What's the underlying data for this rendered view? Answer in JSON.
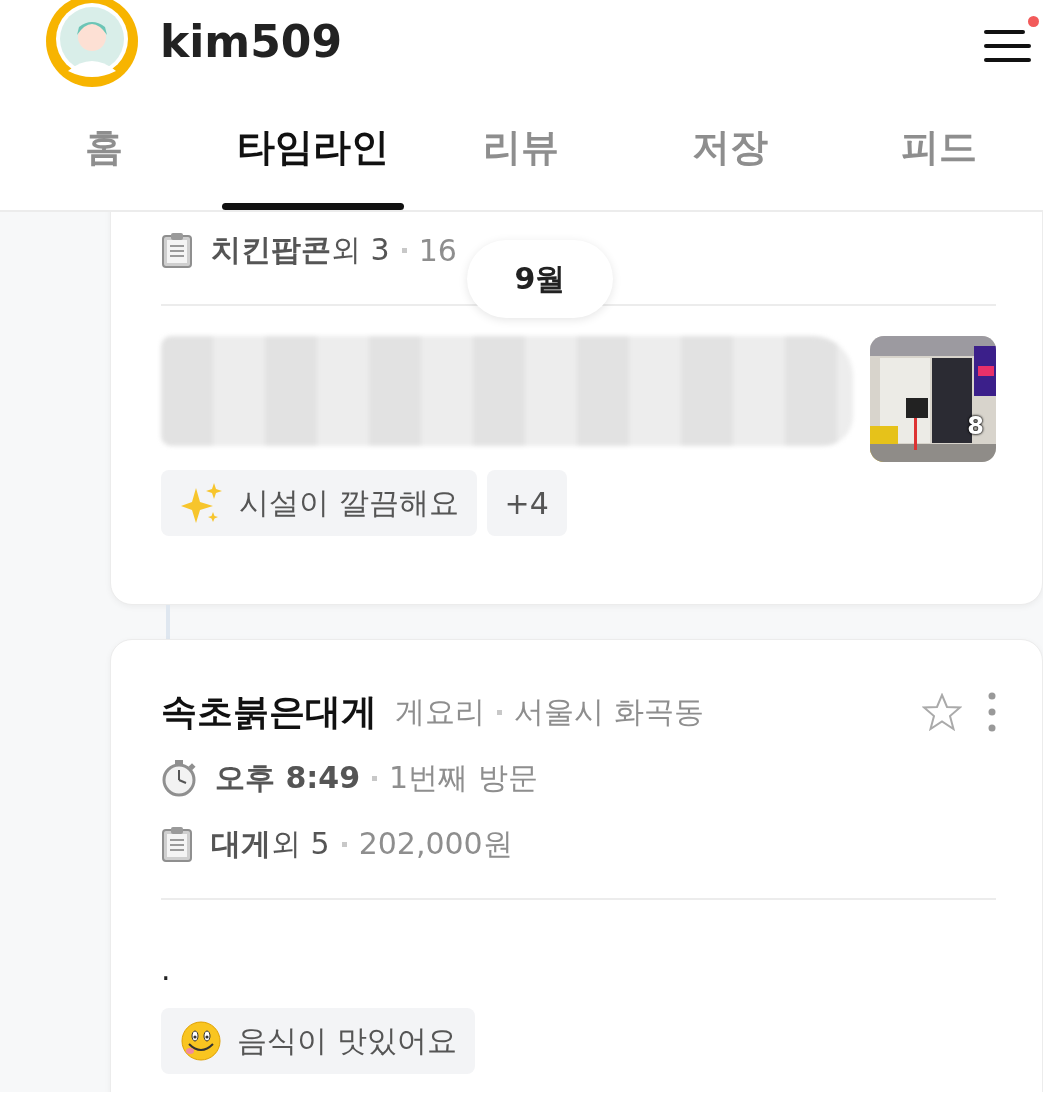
{
  "header": {
    "username": "kim509",
    "menu_badge": true
  },
  "tabs": [
    {
      "label": "홈",
      "selected": false
    },
    {
      "label": "타임라인",
      "selected": true
    },
    {
      "label": "리뷰",
      "selected": false
    },
    {
      "label": "저장",
      "selected": false
    },
    {
      "label": "피드",
      "selected": false
    }
  ],
  "month_label": "9월",
  "cards": [
    {
      "kind": "cut",
      "order": {
        "items": "**치킨팝콘**외 3",
        "price": "16"
      },
      "review_blurred": true,
      "photo": {
        "kind": "picture",
        "count": "8"
      },
      "tags": [
        {
          "kind": "sparkles",
          "label": "시설이 깔끔해요"
        },
        {
          "kind": "plain",
          "label": "+4"
        }
      ]
    },
    {
      "kind": "full",
      "name": "속초붉은대게",
      "category": "게요리",
      "location": "서울시 화곡동",
      "favorite": false,
      "visit": {
        "time": "오후 8:49",
        "count": "1번째 방문"
      },
      "order": {
        "items": "**대게**외 5",
        "price": "202,000원"
      },
      "review": ".",
      "tags": [
        {
          "kind": "smile",
          "label": "음식이 맛있어요"
        }
      ]
    }
  ]
}
